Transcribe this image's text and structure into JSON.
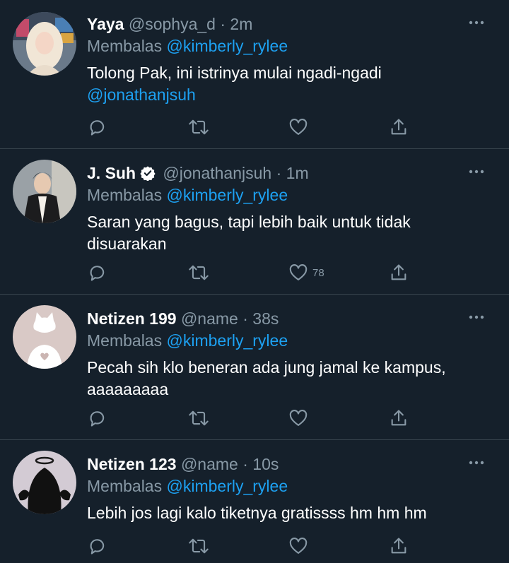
{
  "icons": {
    "reply": "reply-icon",
    "retweet": "retweet-icon",
    "like": "heart-icon",
    "share": "share-icon",
    "more": "more-icon",
    "verified": "verified-badge-icon"
  },
  "colors": {
    "background": "#15202b",
    "muted": "#8899a6",
    "accent": "#1da1f2",
    "divider": "#38444d"
  },
  "tweets": [
    {
      "name": "Yaya",
      "handle": "@sophya_d",
      "dot": "·",
      "time": "2m",
      "replying_label": "Membalas",
      "replying_to": "@kimberly_rylee",
      "text": "Tolong Pak, ini istrinya mulai ngadi-ngadi",
      "text_mention": "@jonathanjsuh",
      "like_count": ""
    },
    {
      "name": "J. Suh",
      "handle": "@jonathanjsuh",
      "dot": "·",
      "time": "1m",
      "replying_label": "Membalas",
      "replying_to": "@kimberly_rylee",
      "text": "Saran yang bagus, tapi lebih baik untuk tidak disuarakan",
      "like_count": "78"
    },
    {
      "name": "Netizen 199",
      "handle": "@name",
      "dot": "·",
      "time": "38s",
      "replying_label": "Membalas",
      "replying_to": "@kimberly_rylee",
      "text": "Pecah sih klo beneran ada jung jamal ke kampus, aaaaaaaaa",
      "like_count": ""
    },
    {
      "name": "Netizen 123",
      "handle": "@name",
      "dot": "·",
      "time": "10s",
      "replying_label": "Membalas",
      "replying_to": "@kimberly_rylee",
      "text": "Lebih jos lagi kalo tiketnya gratissss hm hm hm",
      "like_count": ""
    }
  ]
}
